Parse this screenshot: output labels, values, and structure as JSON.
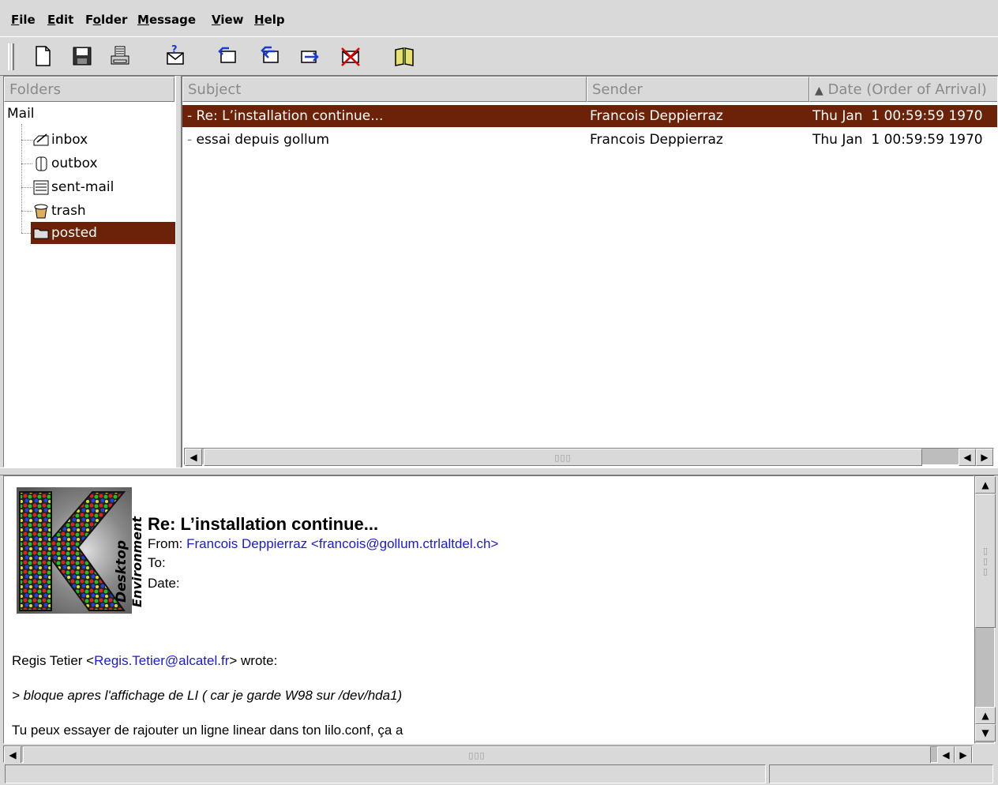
{
  "menubar": {
    "file": {
      "pre": "",
      "u": "F",
      "post": "ile"
    },
    "edit": {
      "pre": "",
      "u": "E",
      "post": "dit"
    },
    "folder": {
      "pre": "F",
      "u": "o",
      "post": "lder"
    },
    "message": {
      "pre": "",
      "u": "M",
      "post": "essage"
    },
    "view": {
      "pre": "",
      "u": "V",
      "post": "iew"
    },
    "help": {
      "pre": "",
      "u": "H",
      "post": "elp"
    }
  },
  "toolbar": {
    "icons": [
      "new-document-icon",
      "save-disk-icon",
      "print-icon",
      "check-mail-icon",
      "reply-icon",
      "reply-all-icon",
      "forward-icon",
      "delete-message-icon",
      "address-book-icon"
    ]
  },
  "folders": {
    "header": "Folders",
    "root": "Mail",
    "items": [
      {
        "label": "inbox",
        "icon": "inbox-folder-icon"
      },
      {
        "label": "outbox",
        "icon": "outbox-folder-icon"
      },
      {
        "label": "sent-mail",
        "icon": "sent-mail-folder-icon"
      },
      {
        "label": "trash",
        "icon": "trash-folder-icon"
      },
      {
        "label": "posted",
        "icon": "posted-folder-icon",
        "selected": true
      }
    ]
  },
  "message_list": {
    "columns": {
      "subject": "Subject",
      "sender": "Sender",
      "date": "Date (Order of Arrival)"
    },
    "sort_indicator": "▲",
    "rows": [
      {
        "subject": "Re: L’installation continue...",
        "sender": "Francois Deppierraz",
        "date": "Thu Jan  1 00:59:59 1970",
        "selected": true
      },
      {
        "subject": "essai depuis gollum",
        "sender": "Francois Deppierraz",
        "date": "Thu Jan  1 00:59:59 1970",
        "selected": false
      }
    ],
    "row_prefix": "-"
  },
  "reader": {
    "logo_text_1": "Desktop",
    "logo_text_2": "Environment",
    "subject": "Re: L’installation continue...",
    "from_label": "From:",
    "from_value": "Francois Deppierraz <francois@gollum.ctrlaltdel.ch>",
    "to_label": "To:",
    "date_label": "Date:",
    "body": {
      "wrote_pre": "Regis Tetier <",
      "wrote_email": "Regis.Tetier@alcatel.fr",
      "wrote_post": "> wrote:",
      "quote": "> bloque apres l'affichage de LI ( car je garde W98 sur /dev/hda1)",
      "line3": "Tu peux essayer de rajouter un ligne linear dans ton lilo.conf, ça a"
    }
  },
  "scrollbars": {
    "grip": "▯▯▯"
  },
  "colors": {
    "selection": "#6b2208",
    "link": "#1a1ad6",
    "background": "#d9d9d9"
  }
}
